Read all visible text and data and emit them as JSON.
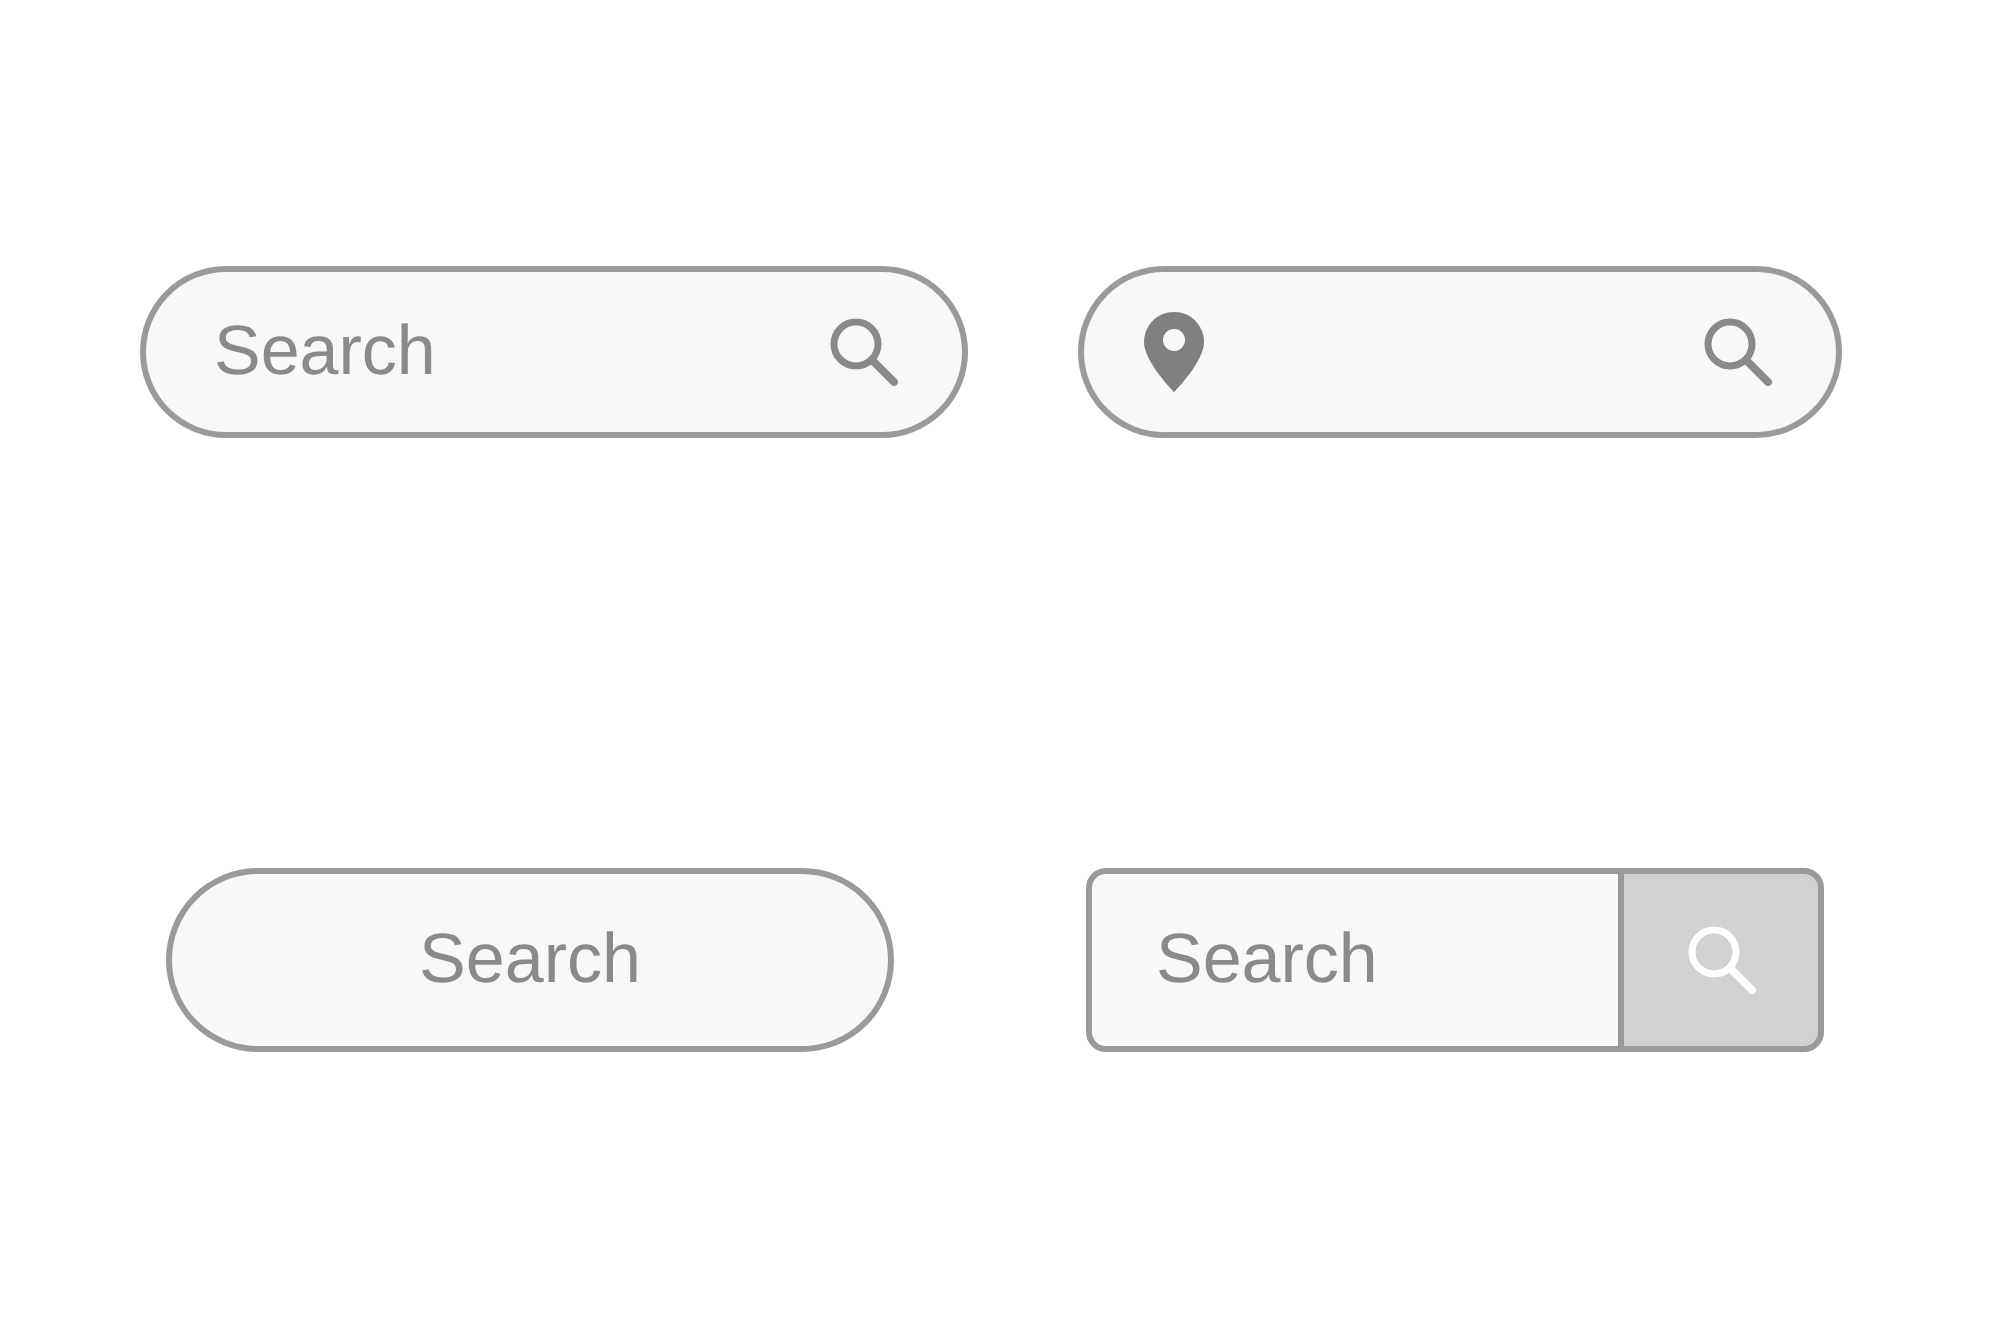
{
  "search_bars": [
    {
      "kind": "icon-right",
      "placeholder": "Search"
    },
    {
      "kind": "location"
    },
    {
      "kind": "centered",
      "placeholder": "Search"
    },
    {
      "kind": "button",
      "placeholder": "Search"
    }
  ]
}
